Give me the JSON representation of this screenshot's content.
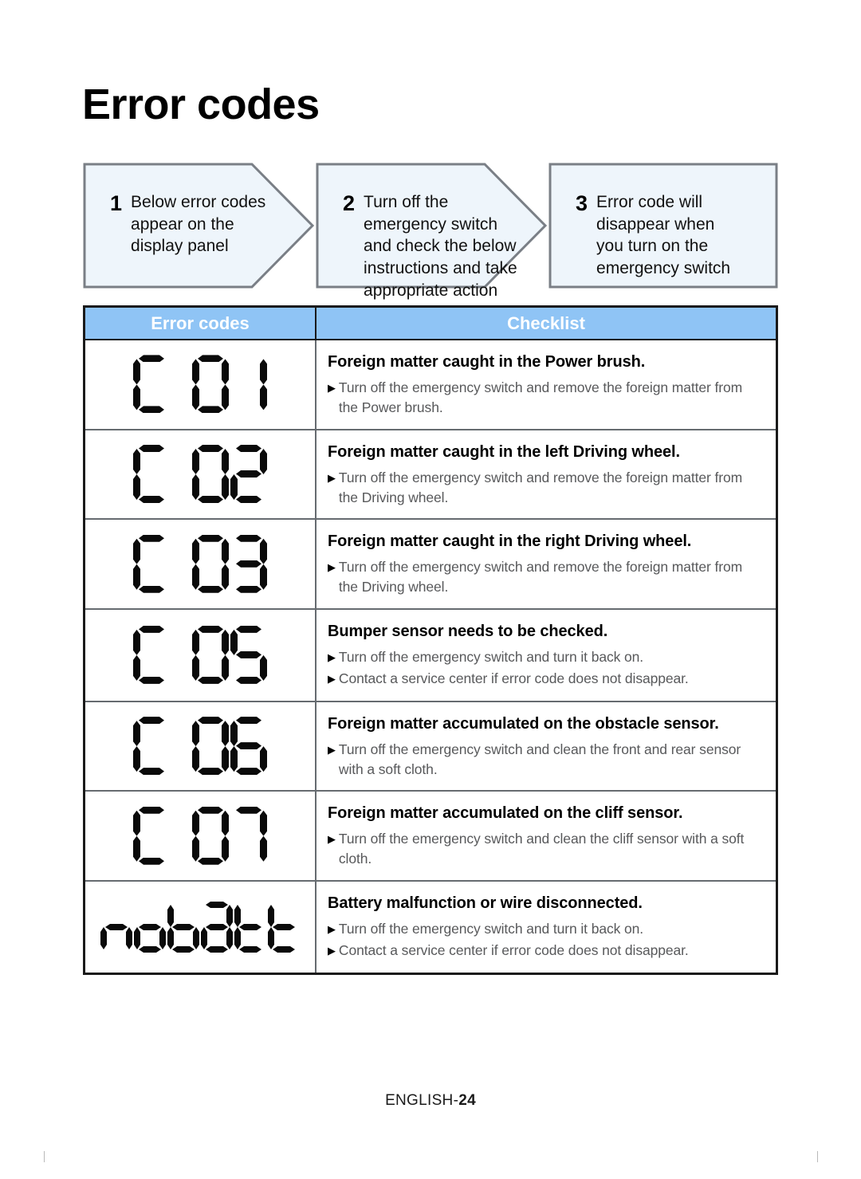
{
  "page": {
    "title": "Error codes",
    "footer_label": "ENGLISH-",
    "footer_page": "24"
  },
  "steps": [
    {
      "number": "1",
      "text": "Below error codes\nappear on the\ndisplay panel",
      "shape": "chevron"
    },
    {
      "number": "2",
      "text": "Turn off the\nemergency switch\nand check the below\ninstructions and take\nappropriate action",
      "shape": "chevron"
    },
    {
      "number": "3",
      "text": "Error code will\ndisappear when\nyou turn on the\nemergency switch",
      "shape": "rectangle"
    }
  ],
  "table": {
    "headers": {
      "code": "Error codes",
      "checklist": "Checklist"
    },
    "rows": [
      {
        "code": "C01",
        "code_display": "C 01",
        "title": "Foreign matter caught in the Power brush.",
        "bullets": [
          "Turn off the emergency switch and remove the foreign matter from the Power brush."
        ]
      },
      {
        "code": "C02",
        "code_display": "C 02",
        "title": "Foreign matter caught in the left Driving wheel.",
        "bullets": [
          "Turn off the emergency switch and remove the foreign matter from the Driving wheel."
        ]
      },
      {
        "code": "C03",
        "code_display": "C 03",
        "title": "Foreign matter caught in the right Driving wheel.",
        "bullets": [
          "Turn off the emergency switch and remove the foreign matter from the Driving wheel."
        ]
      },
      {
        "code": "C05",
        "code_display": "C 05",
        "title": "Bumper sensor needs to be checked.",
        "bullets": [
          "Turn off the emergency switch and turn it back on.",
          "Contact a service center if error code does not disappear."
        ]
      },
      {
        "code": "C06",
        "code_display": "C 06",
        "title": "Foreign matter accumulated on the obstacle sensor.",
        "bullets": [
          "Turn off the emergency switch and clean the front and rear sensor with a soft cloth."
        ]
      },
      {
        "code": "C07",
        "code_display": "C 07",
        "title": "Foreign matter accumulated on the cliff sensor.",
        "bullets": [
          "Turn off the emergency switch and clean the cliff sensor with a soft cloth."
        ]
      },
      {
        "code": "nobatt",
        "code_display": "nobatt",
        "title": "Battery malfunction or wire disconnected.",
        "bullets": [
          "Turn off the emergency switch and turn it back on.",
          "Contact a service center if error code does not disappear."
        ]
      }
    ]
  },
  "icons": {
    "bullet": "triangle-right-icon"
  },
  "colors": {
    "header_blue": "#8fc4f5",
    "step_fill": "#eef5fb",
    "step_border": "#7a7f86",
    "table_border": "#1a1a1a",
    "row_divider": "#666b70",
    "body_text": "#58595b",
    "lcd_segment": "#0a0a0a"
  }
}
